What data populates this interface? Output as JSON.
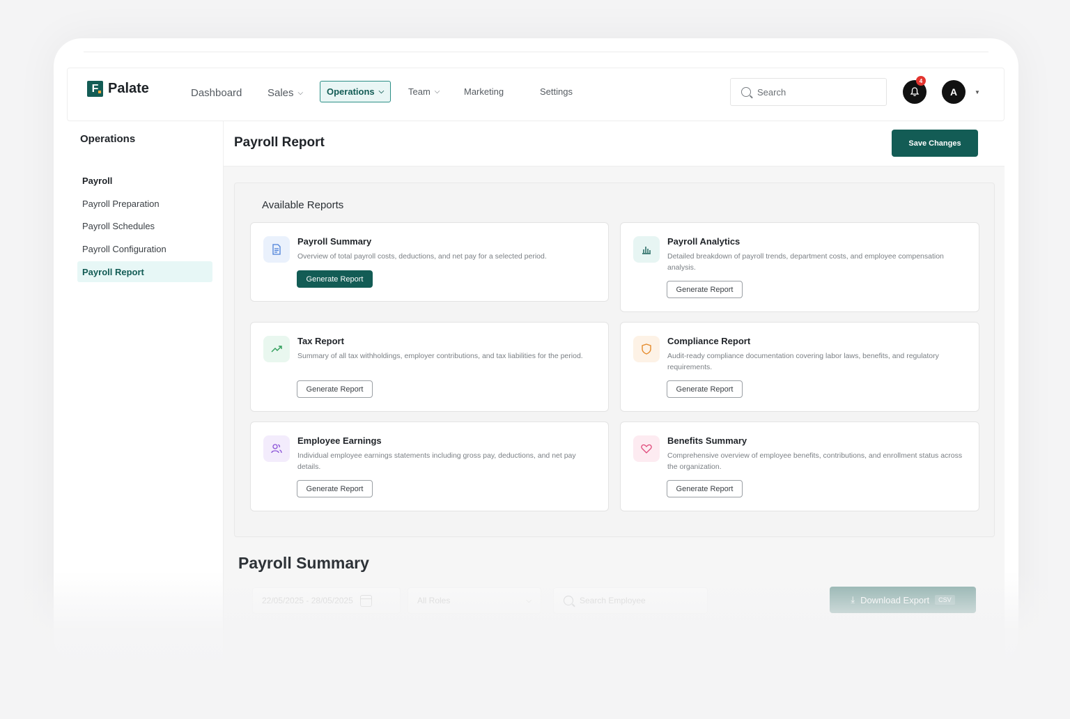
{
  "brand": {
    "name": "Palate",
    "mark": "F"
  },
  "nav": {
    "items": [
      {
        "label": "Dashboard"
      },
      {
        "label": "Sales"
      },
      {
        "label": "Operations"
      },
      {
        "label": "Team"
      },
      {
        "label": "Marketing"
      },
      {
        "label": "Settings"
      }
    ],
    "active": "Operations"
  },
  "search": {
    "placeholder": "Search"
  },
  "notifications": {
    "count": "4"
  },
  "user": {
    "initial": "A"
  },
  "sidebar": {
    "title": "Operations",
    "items": [
      {
        "label": "Payroll"
      },
      {
        "label": "Payroll Preparation"
      },
      {
        "label": "Payroll Schedules"
      },
      {
        "label": "Payroll Configuration"
      },
      {
        "label": "Payroll Report"
      }
    ],
    "active": "Payroll Report"
  },
  "header": {
    "title": "Payroll Report",
    "save_label": "Save Changes"
  },
  "reports": {
    "title": "Available Reports",
    "button_label": "Generate Report",
    "cards": [
      {
        "title": "Payroll Summary",
        "desc": "Overview of total payroll costs, deductions, and net pay for a selected period.",
        "icon": "document-icon",
        "accent": "#4a7fd8"
      },
      {
        "title": "Payroll Analytics",
        "desc": "Detailed breakdown of payroll trends, department costs, and employee compensation analysis.",
        "icon": "bar-chart-icon",
        "accent": "#135c55"
      },
      {
        "title": "Tax Report",
        "desc": "Summary of all tax withholdings, employer contributions, and tax liabilities for the period.",
        "icon": "trend-up-icon",
        "accent": "#2f9e5a"
      },
      {
        "title": "Compliance Report",
        "desc": "Audit-ready compliance documentation covering labor laws, benefits, and regulatory requirements.",
        "icon": "shield-icon",
        "accent": "#e58a2a"
      },
      {
        "title": "Employee Earnings",
        "desc": "Individual employee earnings statements including gross pay, deductions, and net pay details.",
        "icon": "users-icon",
        "accent": "#8a52d8"
      },
      {
        "title": "Benefits Summary",
        "desc": "Comprehensive overview of employee benefits, contributions, and enrollment status across the organization.",
        "icon": "heart-icon",
        "accent": "#e0497a"
      }
    ]
  },
  "summary": {
    "title": "Payroll Summary",
    "date_range": "22/05/2025 - 28/05/2025",
    "roles": "All Roles",
    "search_placeholder": "Search Employee",
    "download_label": "Download Export",
    "download_tag": "CSV"
  }
}
